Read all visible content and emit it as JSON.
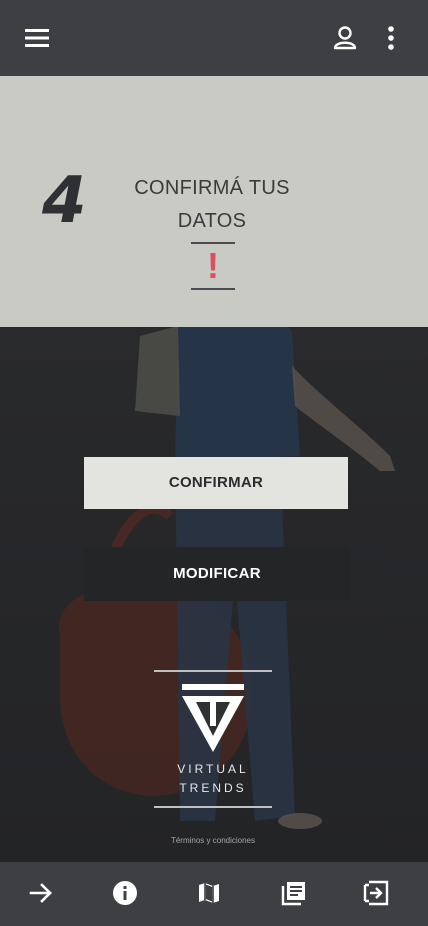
{
  "header": {
    "menu_icon": "menu-icon",
    "account_icon": "person-icon",
    "more_icon": "more-vert-icon"
  },
  "step": {
    "number": "4",
    "title_line1": "CONFIRMÁ TUS",
    "title_line2": "DATOS",
    "alert": "!"
  },
  "actions": {
    "confirm_label": "CONFIRMAR",
    "modify_label": "MODIFICAR"
  },
  "brand": {
    "line1": "VIRTUAL",
    "line2": "TRENDS",
    "terms": "Términos y condiciones"
  },
  "bottom_nav": {
    "items": [
      "arrow-forward-icon",
      "info-icon",
      "map-icon",
      "catalog-icon",
      "exit-icon"
    ]
  },
  "colors": {
    "bar": "#3e3f43",
    "panel": "#d5d6d0",
    "alert": "#d9505e",
    "confirm_bg": "#e3e4df",
    "modify_bg": "#242527"
  }
}
